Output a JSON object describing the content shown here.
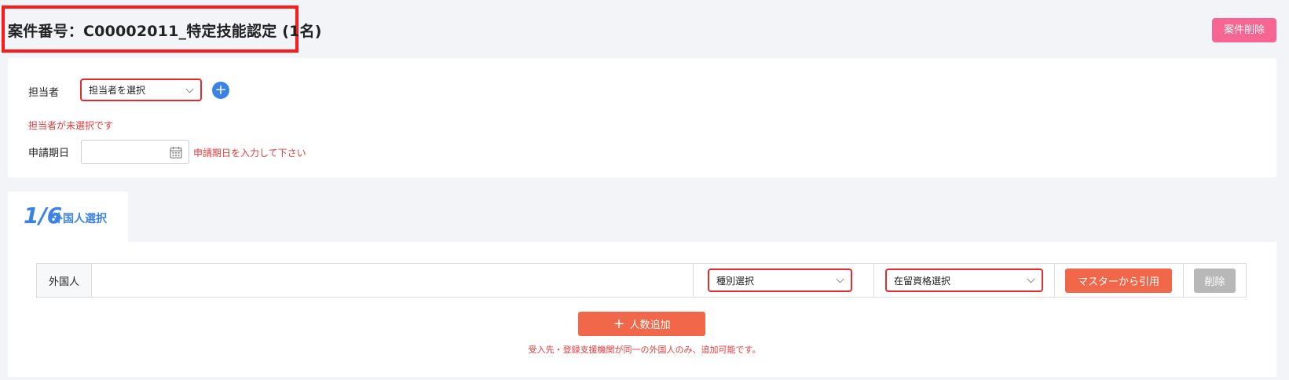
{
  "header": {
    "title": "案件番号：C00002011_特定技能認定 (1名)",
    "delete_case_label": "案件削除"
  },
  "assignee": {
    "label": "担当者",
    "select_value": "担当者を選択",
    "error": "担当者が未選択です"
  },
  "application_date": {
    "label": "申請期日",
    "value": "",
    "error": "申請期日を入力して下さい"
  },
  "step": {
    "number": "1/6",
    "label": "外国人選択"
  },
  "foreigner_row": {
    "label": "外国人",
    "type_select": "種別選択",
    "status_select": "在留資格選択",
    "master_button": "マスターから引用",
    "delete_button": "削除"
  },
  "add_people": {
    "button_label": "人数追加",
    "note": "受入先・登録支援機関が同一の外国人のみ、追加可能です。"
  },
  "colors": {
    "accent_blue": "#3b82e6",
    "primary_orange": "#f0674a",
    "danger_pink": "#f76693",
    "error_red": "#e83a3a"
  }
}
